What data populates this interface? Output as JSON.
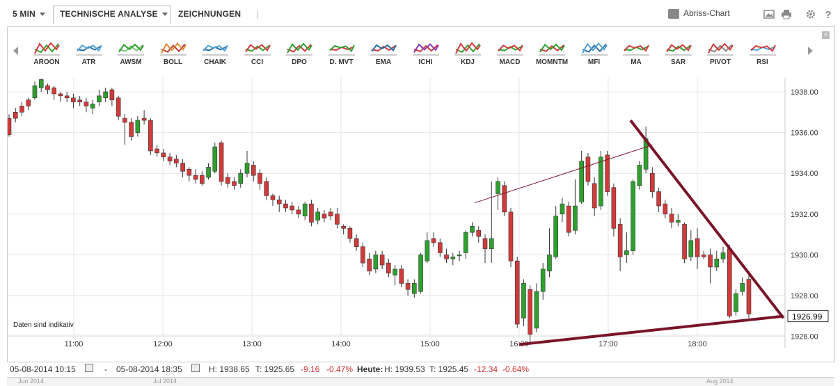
{
  "toolbar": {
    "interval": "5 MIN",
    "analysis": "TECHNISCHE ANALYSE",
    "drawings": "ZEICHNUNGEN",
    "abriss": "Abriss-Chart"
  },
  "indicators": [
    "AROON",
    "ATR",
    "AWSM",
    "BOLL",
    "CHAIK",
    "CCI",
    "DPO",
    "D. MVT",
    "EMA",
    "ICHI",
    "KDJ",
    "MACD",
    "MOMNTM",
    "MFI",
    "MA",
    "SAR",
    "PIVOT",
    "RSI"
  ],
  "chart": {
    "note": "Daten sind indikativ",
    "current_price": "1926.99",
    "y_ticks": [
      "1938.00",
      "1936.00",
      "1934.00",
      "1932.00",
      "1930.00",
      "1928.00",
      "1926.00"
    ],
    "x_ticks": [
      "11:00",
      "12:00",
      "13:00",
      "14:00",
      "15:00",
      "16:00",
      "17:00",
      "18:00"
    ],
    "colors": {
      "up": "#2ea02e",
      "down": "#d23a3a",
      "trend": "#7a1428",
      "grid": "#e6e6e6"
    }
  },
  "chart_data": {
    "type": "candlestick",
    "ylim": [
      1925.65,
      1938.65
    ],
    "x_range": [
      "10:15",
      "18:35"
    ],
    "candles": [
      [
        1936.7,
        1935.9,
        1936.9,
        1935.8
      ],
      [
        1937.0,
        1936.7,
        1937.2,
        1936.5
      ],
      [
        1937.3,
        1937.0,
        1937.5,
        1936.8
      ],
      [
        1937.6,
        1937.3,
        1937.7,
        1937.1
      ],
      [
        1937.7,
        1938.3,
        1938.5,
        1937.6
      ],
      [
        1938.2,
        1938.6,
        1938.65,
        1938.0
      ],
      [
        1938.3,
        1938.1,
        1938.4,
        1937.9
      ],
      [
        1938.2,
        1937.9,
        1938.3,
        1937.6
      ],
      [
        1937.9,
        1937.8,
        1938.0,
        1937.5
      ],
      [
        1937.8,
        1937.7,
        1938.0,
        1937.5
      ],
      [
        1937.7,
        1937.5,
        1937.9,
        1937.2
      ],
      [
        1937.6,
        1937.5,
        1937.8,
        1937.3
      ],
      [
        1937.5,
        1937.3,
        1937.7,
        1937.0
      ],
      [
        1937.2,
        1937.4,
        1937.6,
        1936.9
      ],
      [
        1937.5,
        1937.8,
        1938.1,
        1937.3
      ],
      [
        1937.7,
        1938.0,
        1938.2,
        1937.5
      ],
      [
        1938.1,
        1937.6,
        1938.2,
        1937.3
      ],
      [
        1937.7,
        1936.8,
        1937.8,
        1936.6
      ],
      [
        1936.7,
        1936.5,
        1936.9,
        1935.4
      ],
      [
        1936.5,
        1935.8,
        1936.7,
        1935.6
      ],
      [
        1936.0,
        1936.6,
        1936.8,
        1935.8
      ],
      [
        1936.7,
        1936.6,
        1937.1,
        1936.4
      ],
      [
        1936.6,
        1935.1,
        1936.7,
        1934.9
      ],
      [
        1935.2,
        1935.0,
        1935.4,
        1934.8
      ],
      [
        1935.0,
        1934.8,
        1935.2,
        1934.6
      ],
      [
        1934.8,
        1934.6,
        1935.0,
        1934.4
      ],
      [
        1934.7,
        1934.5,
        1934.9,
        1934.3
      ],
      [
        1934.5,
        1934.1,
        1934.7,
        1933.8
      ],
      [
        1934.2,
        1933.9,
        1934.3,
        1933.6
      ],
      [
        1933.9,
        1933.7,
        1934.2,
        1933.5
      ],
      [
        1933.9,
        1933.5,
        1934.1,
        1933.4
      ],
      [
        1933.8,
        1934.3,
        1934.5,
        1933.7
      ],
      [
        1934.1,
        1935.3,
        1935.5,
        1934.0
      ],
      [
        1935.5,
        1933.6,
        1935.6,
        1933.4
      ],
      [
        1933.8,
        1933.5,
        1934.0,
        1933.3
      ],
      [
        1933.6,
        1933.4,
        1933.8,
        1933.2
      ],
      [
        1933.5,
        1934.0,
        1934.2,
        1933.3
      ],
      [
        1934.0,
        1934.5,
        1935.1,
        1933.8
      ],
      [
        1934.4,
        1933.9,
        1934.6,
        1933.6
      ],
      [
        1934.0,
        1933.5,
        1934.2,
        1933.2
      ],
      [
        1933.6,
        1932.9,
        1933.8,
        1932.7
      ],
      [
        1932.9,
        1932.7,
        1933.0,
        1932.4
      ],
      [
        1932.7,
        1932.5,
        1932.9,
        1932.1
      ],
      [
        1932.5,
        1932.3,
        1932.7,
        1932.1
      ],
      [
        1932.4,
        1932.2,
        1932.6,
        1932.0
      ],
      [
        1932.2,
        1932.0,
        1932.4,
        1931.8
      ],
      [
        1931.9,
        1932.5,
        1932.6,
        1931.7
      ],
      [
        1932.5,
        1931.6,
        1932.7,
        1931.4
      ],
      [
        1931.7,
        1932.1,
        1932.3,
        1931.5
      ],
      [
        1932.0,
        1931.8,
        1932.2,
        1931.6
      ],
      [
        1932.1,
        1931.9,
        1932.3,
        1931.7
      ],
      [
        1932.0,
        1931.5,
        1932.3,
        1931.3
      ],
      [
        1931.4,
        1931.3,
        1931.5,
        1931.0
      ],
      [
        1931.3,
        1930.8,
        1931.4,
        1930.6
      ],
      [
        1930.8,
        1930.4,
        1931.0,
        1930.2
      ],
      [
        1930.4,
        1929.6,
        1930.6,
        1929.4
      ],
      [
        1929.8,
        1929.2,
        1930.1,
        1929.0
      ],
      [
        1929.3,
        1930.0,
        1930.2,
        1929.1
      ],
      [
        1930.0,
        1929.5,
        1930.2,
        1929.3
      ],
      [
        1929.6,
        1929.1,
        1929.8,
        1928.9
      ],
      [
        1929.0,
        1929.3,
        1929.5,
        1928.5
      ],
      [
        1929.3,
        1928.6,
        1929.5,
        1928.4
      ],
      [
        1928.6,
        1928.3,
        1928.8,
        1928.0
      ],
      [
        1928.1,
        1928.6,
        1928.8,
        1927.9
      ],
      [
        1928.2,
        1930.0,
        1930.1,
        1928.1
      ],
      [
        1929.7,
        1930.7,
        1931.1,
        1929.6
      ],
      [
        1930.8,
        1930.6,
        1931.1,
        1930.4
      ],
      [
        1930.6,
        1930.1,
        1930.8,
        1929.9
      ],
      [
        1930.0,
        1929.8,
        1930.3,
        1929.6
      ],
      [
        1929.8,
        1929.9,
        1930.1,
        1929.5
      ],
      [
        1930.0,
        1930.0,
        1930.2,
        1929.7
      ],
      [
        1930.1,
        1931.1,
        1931.2,
        1929.8
      ],
      [
        1931.1,
        1931.4,
        1931.6,
        1930.9
      ],
      [
        1931.2,
        1930.9,
        1931.4,
        1930.6
      ],
      [
        1930.8,
        1930.3,
        1931.0,
        1929.6
      ],
      [
        1930.3,
        1930.8,
        1933.6,
        1929.6
      ],
      [
        1933.0,
        1933.6,
        1933.8,
        1932.2
      ],
      [
        1933.4,
        1932.1,
        1933.6,
        1931.9
      ],
      [
        1932.1,
        1929.7,
        1932.3,
        1929.4
      ],
      [
        1929.7,
        1926.6,
        1929.9,
        1926.4
      ],
      [
        1926.9,
        1928.6,
        1928.8,
        1926.5
      ],
      [
        1928.3,
        1926.1,
        1928.5,
        1925.65
      ],
      [
        1926.4,
        1928.2,
        1928.6,
        1926.2
      ],
      [
        1928.2,
        1929.3,
        1929.6,
        1927.8
      ],
      [
        1929.2,
        1930.0,
        1931.3,
        1928.9
      ],
      [
        1929.9,
        1931.9,
        1932.4,
        1929.8
      ],
      [
        1932.0,
        1932.5,
        1932.8,
        1931.6
      ],
      [
        1932.4,
        1931.1,
        1932.6,
        1930.9
      ],
      [
        1931.2,
        1932.4,
        1933.7,
        1931.0
      ],
      [
        1932.6,
        1934.6,
        1935.1,
        1932.5
      ],
      [
        1934.8,
        1933.6,
        1935.0,
        1933.4
      ],
      [
        1933.5,
        1932.3,
        1933.8,
        1931.9
      ],
      [
        1932.4,
        1934.8,
        1935.1,
        1932.2
      ],
      [
        1934.9,
        1933.1,
        1935.1,
        1932.9
      ],
      [
        1933.3,
        1931.3,
        1933.5,
        1930.9
      ],
      [
        1931.5,
        1929.9,
        1931.8,
        1929.2
      ],
      [
        1930.0,
        1930.2,
        1931.1,
        1929.6
      ],
      [
        1930.2,
        1933.6,
        1933.7,
        1930.0
      ],
      [
        1933.4,
        1934.4,
        1934.6,
        1933.2
      ],
      [
        1934.2,
        1935.7,
        1936.3,
        1934.0
      ],
      [
        1934.0,
        1933.1,
        1934.3,
        1932.8
      ],
      [
        1933.1,
        1932.4,
        1933.3,
        1932.1
      ],
      [
        1932.5,
        1932.0,
        1932.7,
        1931.8
      ],
      [
        1932.0,
        1931.6,
        1932.3,
        1931.3
      ],
      [
        1931.6,
        1931.7,
        1932.0,
        1931.4
      ],
      [
        1931.5,
        1929.8,
        1931.6,
        1929.6
      ],
      [
        1929.9,
        1930.7,
        1931.2,
        1929.7
      ],
      [
        1930.8,
        1929.9,
        1931.3,
        1929.3
      ],
      [
        1930.0,
        1929.9,
        1930.2,
        1929.8
      ],
      [
        1930.0,
        1929.4,
        1930.3,
        1928.6
      ],
      [
        1929.4,
        1929.8,
        1930.2,
        1929.2
      ],
      [
        1929.8,
        1930.1,
        1930.4,
        1929.6
      ],
      [
        1930.3,
        1927.0,
        1930.5,
        1926.9
      ],
      [
        1927.2,
        1928.1,
        1928.3,
        1927.0
      ],
      [
        1928.2,
        1928.6,
        1928.9,
        1928.0
      ],
      [
        1928.8,
        1927.1,
        1929.0,
        1926.9
      ]
    ],
    "trendlines": [
      {
        "from": [
          "15:30",
          1932.55
        ],
        "to": [
          "17:30",
          1935.4
        ]
      },
      {
        "from": [
          "17:15",
          1936.6
        ],
        "to": [
          "18:58",
          1926.9
        ]
      },
      {
        "from": [
          "16:00",
          1925.6
        ],
        "to": [
          "18:58",
          1926.99
        ]
      }
    ]
  },
  "footer": {
    "from_date": "05-08-2014 10:15",
    "dash": "-",
    "to_date": "05-08-2014 18:35",
    "high": "H: 1938.65",
    "low": "T: 1925.65",
    "change": "-9.16",
    "change_pct": "-0.47%",
    "today_label": "Heute:",
    "today_high": "H: 1939.53",
    "today_low": "T: 1925.45",
    "today_change": "-12.34",
    "today_change_pct": "-0.64%"
  },
  "navigator": {
    "labels": [
      "Jun 2014",
      "Jul 2014",
      "Aug 2014"
    ]
  }
}
